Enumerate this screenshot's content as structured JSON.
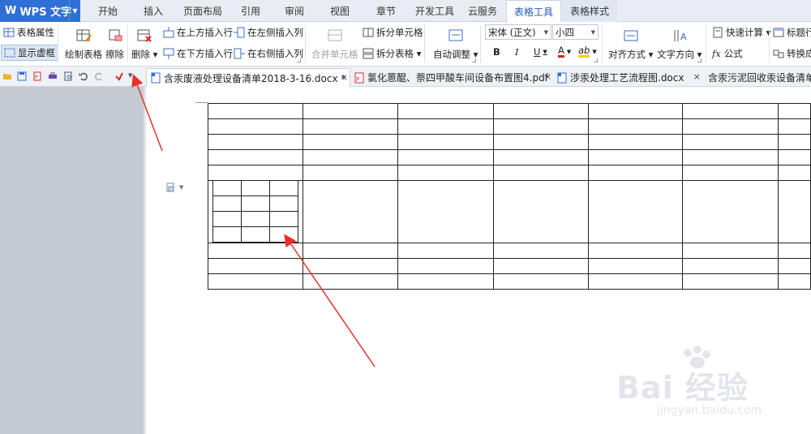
{
  "app": {
    "name": "WPS 文字",
    "logo": "W"
  },
  "menu_tabs": [
    {
      "label": "开始"
    },
    {
      "label": "插入"
    },
    {
      "label": "页面布局"
    },
    {
      "label": "引用"
    },
    {
      "label": "审阅"
    },
    {
      "label": "视图"
    },
    {
      "label": "章节"
    },
    {
      "label": "开发工具"
    },
    {
      "label": "云服务"
    },
    {
      "label": "表格工具"
    },
    {
      "label": "表格样式"
    }
  ],
  "ribbon": {
    "table_props": "表格属性",
    "show_gridlines": "显示虚框",
    "draw_table": "绘制表格",
    "erase": "擦除",
    "delete": "删除",
    "insert_above": "在上方插入行",
    "insert_below": "在下方插入行",
    "insert_left": "在左侧插入列",
    "insert_right": "在右侧插入列",
    "merge_cells": "合并单元格",
    "split_cells": "拆分单元格",
    "split_table": "拆分表格",
    "autofit": "自动调整",
    "font_name": "宋体 (正文)",
    "font_size": "小四",
    "bold": "B",
    "italic": "I",
    "underline": "U",
    "font_color": "A",
    "highlight": "ab",
    "align": "对齐方式",
    "text_direction": "文字方向",
    "quick_calc": "快速计算",
    "formula": "公式",
    "title_row": "标题行",
    "convert": "转换成"
  },
  "doc_tabs": [
    {
      "label": "含汞废液处理设备清单2018-3-16.docx *",
      "close": "×"
    },
    {
      "label": "氯化蒽醌、萘四甲酸车间设备布置图4.pdf",
      "close": "×"
    },
    {
      "label": "涉汞处理工艺流程图.docx",
      "close": "×"
    },
    {
      "label": "含汞污泥回收汞设备清单",
      "close": ""
    }
  ],
  "watermark": {
    "brand": "Bai 经验",
    "url": "jingyan.baidu.com"
  },
  "colors": {
    "accent": "#2f6fd6",
    "arrow": "#e8312a",
    "font_color_red": "#d92121",
    "highlight_yellow": "#f5d000"
  }
}
